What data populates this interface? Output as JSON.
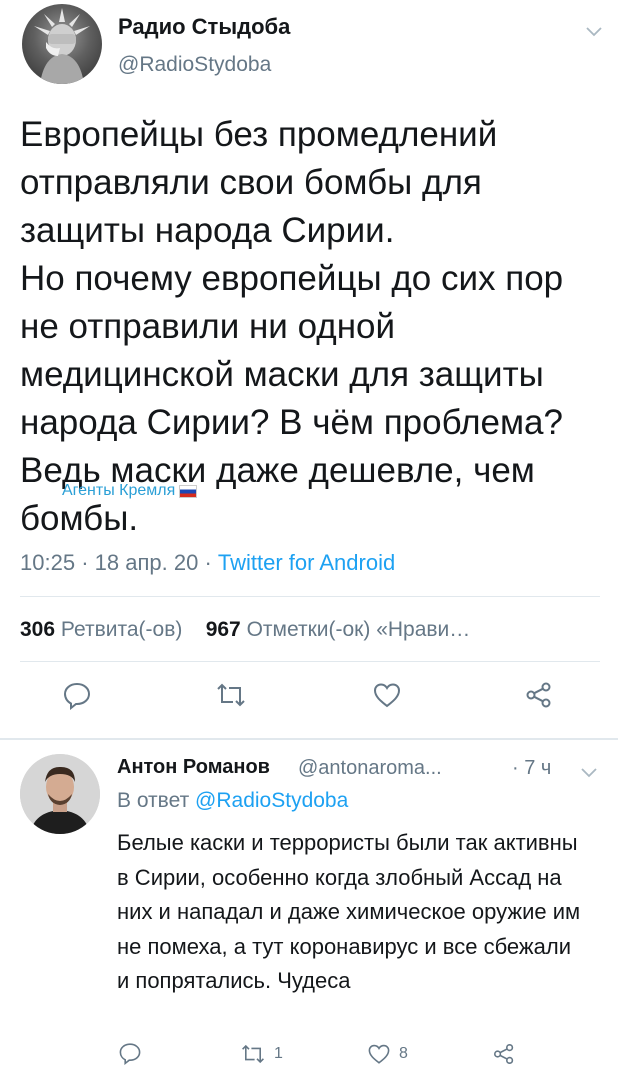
{
  "tweet": {
    "author_name": "Радио Стыдоба",
    "author_handle": "@RadioStydoba",
    "body": "Европейцы без промедлений отправляли свои бомбы для защиты народа Сирии.\nНо почему европейцы до сих пор не отправили ни одной медицинской маски для защиты народа Сирии? В чём проблема? Ведь маски даже дешевле, чем бомбы.",
    "watermark": "Агенты Кремля",
    "time": "10:25",
    "date": "18 апр. 20",
    "source": "Twitter for Android",
    "retweets_count": "306",
    "retweets_label": "Ретвита(-ов)",
    "likes_count": "967",
    "likes_label": "Отметки(-ок)",
    "likes_extra": "«Нрави…"
  },
  "reply": {
    "author_name": "Антон Романов",
    "author_handle": "@antonaroma...",
    "time": "· 7 ч",
    "reply_to_label": "В ответ",
    "reply_to_handle": "@RadioStydoba",
    "body": "Белые каски и террористы были так активны в Сирии, особенно когда злобный Ассад на них и нападал и даже химическое оружие им не помеха, а тут коронавирус и все сбежали и попрятались. Чудеса",
    "retweet_count": "1",
    "like_count": "8"
  },
  "colors": {
    "link": "#1da1f2",
    "secondary": "#657786",
    "icon": "#657786",
    "divider": "#e1e8ed"
  },
  "icons": [
    "chevron-down-icon",
    "reply-icon",
    "retweet-icon",
    "like-icon",
    "share-icon"
  ]
}
